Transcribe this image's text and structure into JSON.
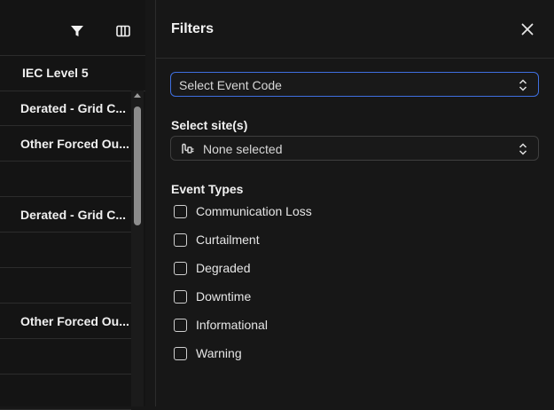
{
  "grid": {
    "column_header": "IEC Level 5",
    "rows": [
      "Derated - Grid C...",
      "Other Forced Ou...",
      "",
      "Derated - Grid C...",
      "",
      "",
      "Other Forced Ou...",
      "",
      ""
    ]
  },
  "filters": {
    "title": "Filters",
    "event_code_placeholder": "Select Event Code",
    "site_label": "Select site(s)",
    "site_value": "None selected",
    "event_types_label": "Event Types",
    "event_types": [
      "Communication Loss",
      "Curtailment",
      "Degraded",
      "Downtime",
      "Informational",
      "Warning"
    ]
  },
  "colors": {
    "focus_border": "#3f6fe0",
    "background": "#171717"
  }
}
